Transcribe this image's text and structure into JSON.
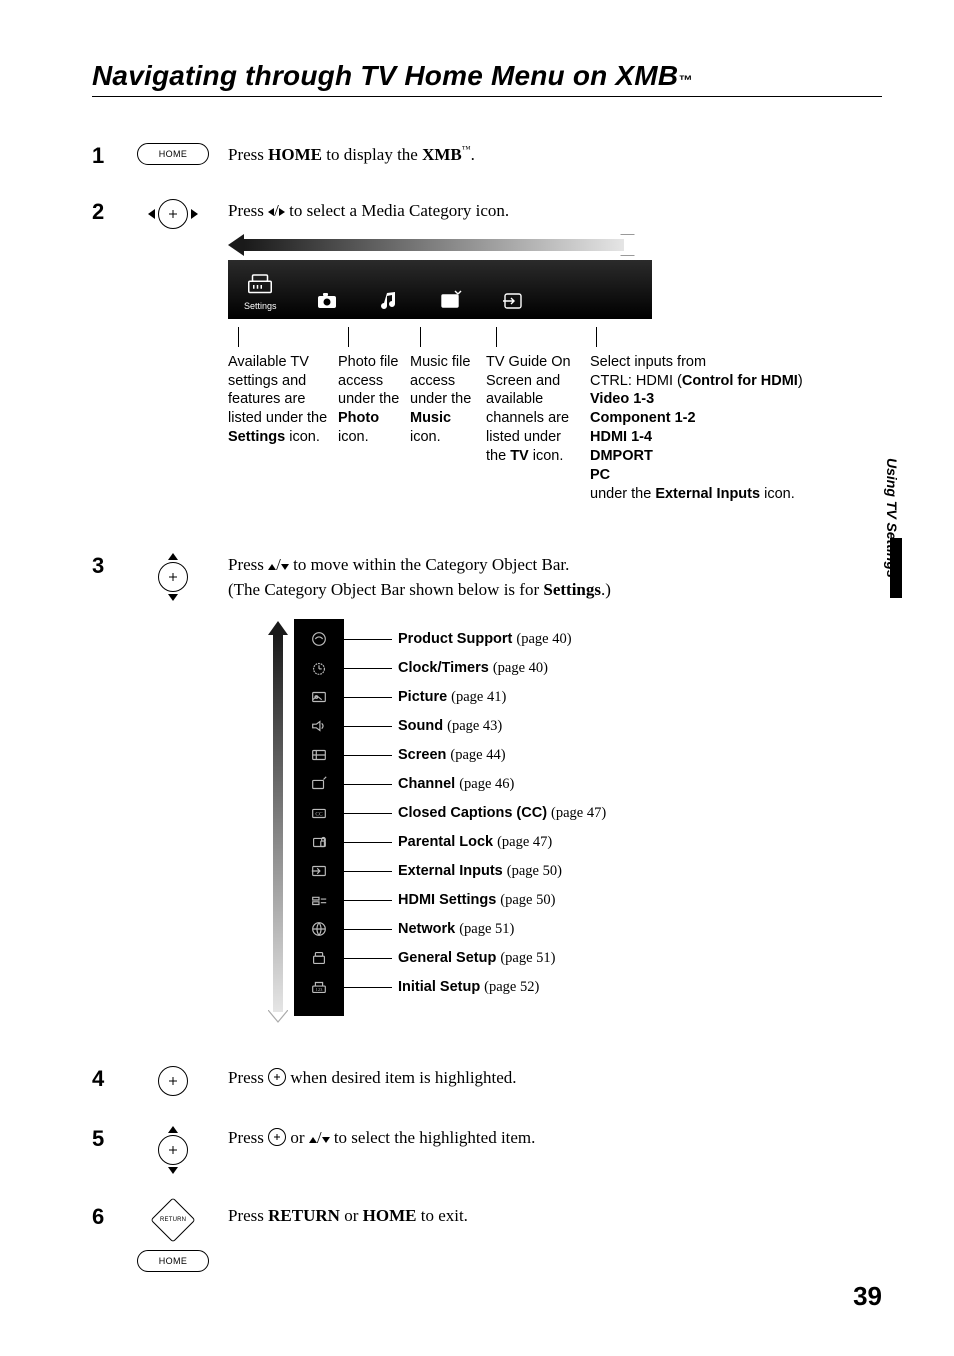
{
  "title": "Navigating through TV Home Menu on XMB",
  "title_tm": "™",
  "side_tab": "Using TV Settings",
  "page_number": "39",
  "home_label": "HOME",
  "xmb_settings_label": "Settings",
  "steps": {
    "s1": {
      "num": "1",
      "pre": "Press ",
      "b1": "HOME",
      "mid": " to display the ",
      "b2": "XMB",
      "tm": "™",
      "post": "."
    },
    "s2": {
      "num": "2",
      "pre": "Press ",
      "arrows": "V/v",
      "post": " to select a Media Category icon."
    },
    "s3": {
      "num": "3",
      "l1_pre": "Press ",
      "l1_arrows": "V/v",
      "l1_post": " to move within the Category Object Bar.",
      "l2_pre": "(The Category Object Bar shown below is for ",
      "l2_b": "Settings",
      "l2_post": ".)"
    },
    "s4": {
      "num": "4",
      "pre": "Press ",
      "post": " when desired item is highlighted."
    },
    "s5": {
      "num": "5",
      "pre": "Press ",
      "mid": " or ",
      "arrows": "V/v",
      "post": " to select the highlighted item."
    },
    "s6": {
      "num": "6",
      "pre": "Press ",
      "b1": "RETURN",
      "mid": " or ",
      "b2": "HOME",
      "post": " to exit."
    }
  },
  "cats": {
    "settings": {
      "l1": "Available TV settings and features are listed under the ",
      "b": "Settings",
      "l2": " icon."
    },
    "photo": {
      "l1": "Photo file access under the ",
      "b": "Photo",
      "l2": " icon."
    },
    "music": {
      "l1": "Music file access under the ",
      "b": "Music",
      "l2": " icon."
    },
    "tv": {
      "l1": "TV Guide On Screen and available channels are listed under the ",
      "b": "TV",
      "l2": " icon."
    },
    "ext": {
      "l1": "Select inputs from",
      "b1": "CTRL: HDMI (",
      "b1b": "Control for HDMI",
      "b1c": ")",
      "b2": "Video 1-3",
      "b3": "Component 1-2",
      "b4": "HDMI 1-4",
      "b5": "DMPORT",
      "b6": "PC",
      "l2a": "under the ",
      "l2b": "External Inputs",
      "l2c": " icon."
    }
  },
  "legend": [
    {
      "label": "Product Support",
      "page": "(page 40)"
    },
    {
      "label": "Clock/Timers",
      "page": "(page 40)"
    },
    {
      "label": "Picture",
      "page": "(page 41)"
    },
    {
      "label": "Sound",
      "page": "(page 43)"
    },
    {
      "label": "Screen",
      "page": "(page 44)"
    },
    {
      "label": "Channel",
      "page": "(page 46)"
    },
    {
      "label": "Closed Captions (CC)",
      "page": "(page 47)"
    },
    {
      "label": "Parental Lock",
      "page": "(page 47)"
    },
    {
      "label": "External Inputs",
      "page": "(page 50)"
    },
    {
      "label": "HDMI Settings",
      "page": "(page 50)"
    },
    {
      "label": "Network",
      "page": "(page 51)"
    },
    {
      "label": "General Setup",
      "page": "(page 51)"
    },
    {
      "label": "Initial Setup",
      "page": "(page 52)"
    }
  ],
  "return_label": "RETURN"
}
